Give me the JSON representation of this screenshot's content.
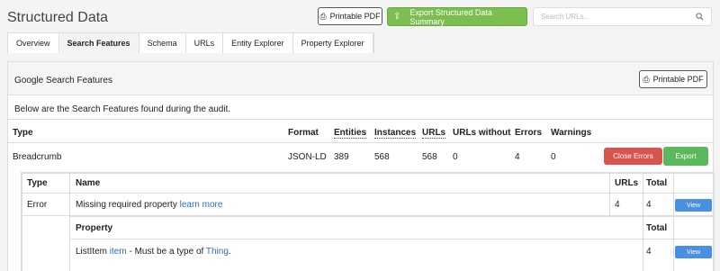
{
  "header": {
    "title": "Structured Data",
    "printable_pdf": "Printable PDF",
    "export_summary": "Export Structured Data Summary",
    "search_placeholder": "Search URLs..."
  },
  "tabs": [
    "Overview",
    "Search Features",
    "Schema",
    "URLs",
    "Entity Explorer",
    "Property Explorer"
  ],
  "panel": {
    "title": "Google Search Features",
    "printable_pdf": "Printable PDF",
    "description": "Below are the Search Features found during the audit."
  },
  "features_table": {
    "headers": {
      "type": "Type",
      "format": "Format",
      "entities": "Entities",
      "instances": "Instances",
      "urls": "URLs",
      "urls_without": "URLs without",
      "errors": "Errors",
      "warnings": "Warnings"
    },
    "row": {
      "type": "Breadcrumb",
      "format": "JSON-LD",
      "entities": "389",
      "instances": "568",
      "urls": "568",
      "urls_without": "0",
      "errors": "4",
      "warnings": "0",
      "close_errors": "Close Errors",
      "export": "Export"
    }
  },
  "issues_table": {
    "headers": {
      "type": "Type",
      "name": "Name",
      "urls": "URLs",
      "total": "Total"
    },
    "row": {
      "type": "Error",
      "name": "Missing required property",
      "learn_more": "learn more",
      "urls": "4",
      "total": "4",
      "view": "View"
    }
  },
  "property_table": {
    "headers": {
      "property": "Property",
      "total": "Total"
    },
    "row": {
      "prefix": "ListItem",
      "item": "item",
      "middle": " - Must be a type of ",
      "type": "Thing",
      "suffix": ".",
      "total": "4",
      "view": "View"
    }
  },
  "colors": {
    "accent_green": "#7cbf50",
    "danger_red": "#d9534f",
    "action_blue": "#4a90e2",
    "link": "#2a6ebb"
  }
}
